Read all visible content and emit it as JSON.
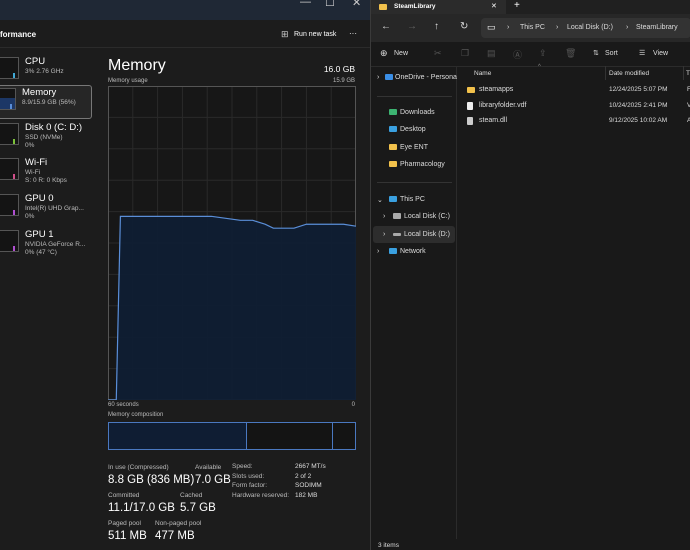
{
  "task_manager": {
    "header": "formance",
    "run_new_task": "Run new task",
    "more": "···",
    "window_controls": [
      "—",
      "☐",
      "✕"
    ],
    "sidebar": [
      {
        "name": "CPU",
        "sub1": "3% 2.76 GHz",
        "sub2": "",
        "color": "#3fa9d6"
      },
      {
        "name": "Memory",
        "sub1": "8.9/15.9 GB (56%)",
        "sub2": "",
        "color": "#5a8ed8",
        "selected": true
      },
      {
        "name": "Disk 0 (C: D:)",
        "sub1": "SSD (NVMe)",
        "sub2": "0%",
        "color": "#7cc23a"
      },
      {
        "name": "Wi-Fi",
        "sub1": "Wi-Fi",
        "sub2": "S: 0 R: 0 Kbps",
        "color": "#d14f8a"
      },
      {
        "name": "GPU 0",
        "sub1": "Intel(R) UHD Grap...",
        "sub2": "0%",
        "color": "#b04fd1"
      },
      {
        "name": "GPU 1",
        "sub1": "NVIDIA GeForce R...",
        "sub2": "0% (47 °C)",
        "color": "#b04fd1"
      }
    ],
    "title": "Memory",
    "total": "16.0 GB",
    "usage_label": "Memory usage",
    "usage_max": "15.9 GB",
    "axis_left": "60 seconds",
    "axis_right": "0",
    "composition_label": "Memory composition",
    "composition_fractions": {
      "in_use": 0.56,
      "modified": 0.35,
      "free": 0.09
    },
    "stats": {
      "in_use_label": "In use (Compressed)",
      "in_use": "8.8 GB (836 MB)",
      "available_label": "Available",
      "available": "7.0 GB",
      "committed_label": "Committed",
      "committed": "11.1/17.0 GB",
      "cached_label": "Cached",
      "cached": "5.7 GB",
      "paged_label": "Paged pool",
      "paged": "511 MB",
      "nonpaged_label": "Non-paged pool",
      "nonpaged": "477 MB"
    },
    "specs": [
      [
        "Speed:",
        "2667 MT/s"
      ],
      [
        "Slots used:",
        "2 of 2"
      ],
      [
        "Form factor:",
        "SODIMM"
      ],
      [
        "Hardware reserved:",
        "182 MB"
      ]
    ]
  },
  "chart_data": {
    "type": "area",
    "title": "Memory usage",
    "xlim": [
      60,
      0
    ],
    "ylim": [
      0,
      15.9
    ],
    "x": [
      60,
      58,
      57,
      50,
      40,
      35,
      28,
      25,
      22,
      20,
      15,
      12,
      8,
      3,
      0
    ],
    "values": [
      0,
      0,
      9.3,
      9.3,
      9.3,
      9.3,
      9.1,
      9.1,
      8.9,
      8.7,
      8.7,
      8.9,
      8.9,
      8.9,
      8.8
    ],
    "color": "#5a8ed8"
  },
  "explorer": {
    "tab": "SteamLibrary",
    "tab_close": "✕",
    "new_tab": "+",
    "breadcrumb": [
      "This PC",
      "Local Disk (D:)",
      "SteamLibrary"
    ],
    "toolbar": {
      "new": "New",
      "sort": "Sort",
      "view": "View"
    },
    "nav": {
      "onedrive": "OneDrive - Persona",
      "quick": [
        {
          "label": "Downloads",
          "icon": "download-icon"
        },
        {
          "label": "Desktop",
          "icon": "desktop-icon"
        },
        {
          "label": "Eye ENT",
          "icon": "folder-icon"
        },
        {
          "label": "Pharmacology",
          "icon": "folder-icon"
        }
      ],
      "this_pc": "This PC",
      "drives": [
        "Local Disk (C:)",
        "Local Disk (D:)"
      ],
      "network": "Network"
    },
    "columns": [
      "Name",
      "Date modified",
      "T"
    ],
    "files": [
      {
        "name": "steamapps",
        "date": "12/24/2025 5:07 PM",
        "type": "F",
        "icon": "folder-icon"
      },
      {
        "name": "libraryfolder.vdf",
        "date": "10/24/2025 2:41 PM",
        "type": "V",
        "icon": "file-icon"
      },
      {
        "name": "steam.dll",
        "date": "9/12/2025 10:02 AM",
        "type": "A",
        "icon": "dll-file-icon"
      }
    ],
    "status": "3 items"
  }
}
